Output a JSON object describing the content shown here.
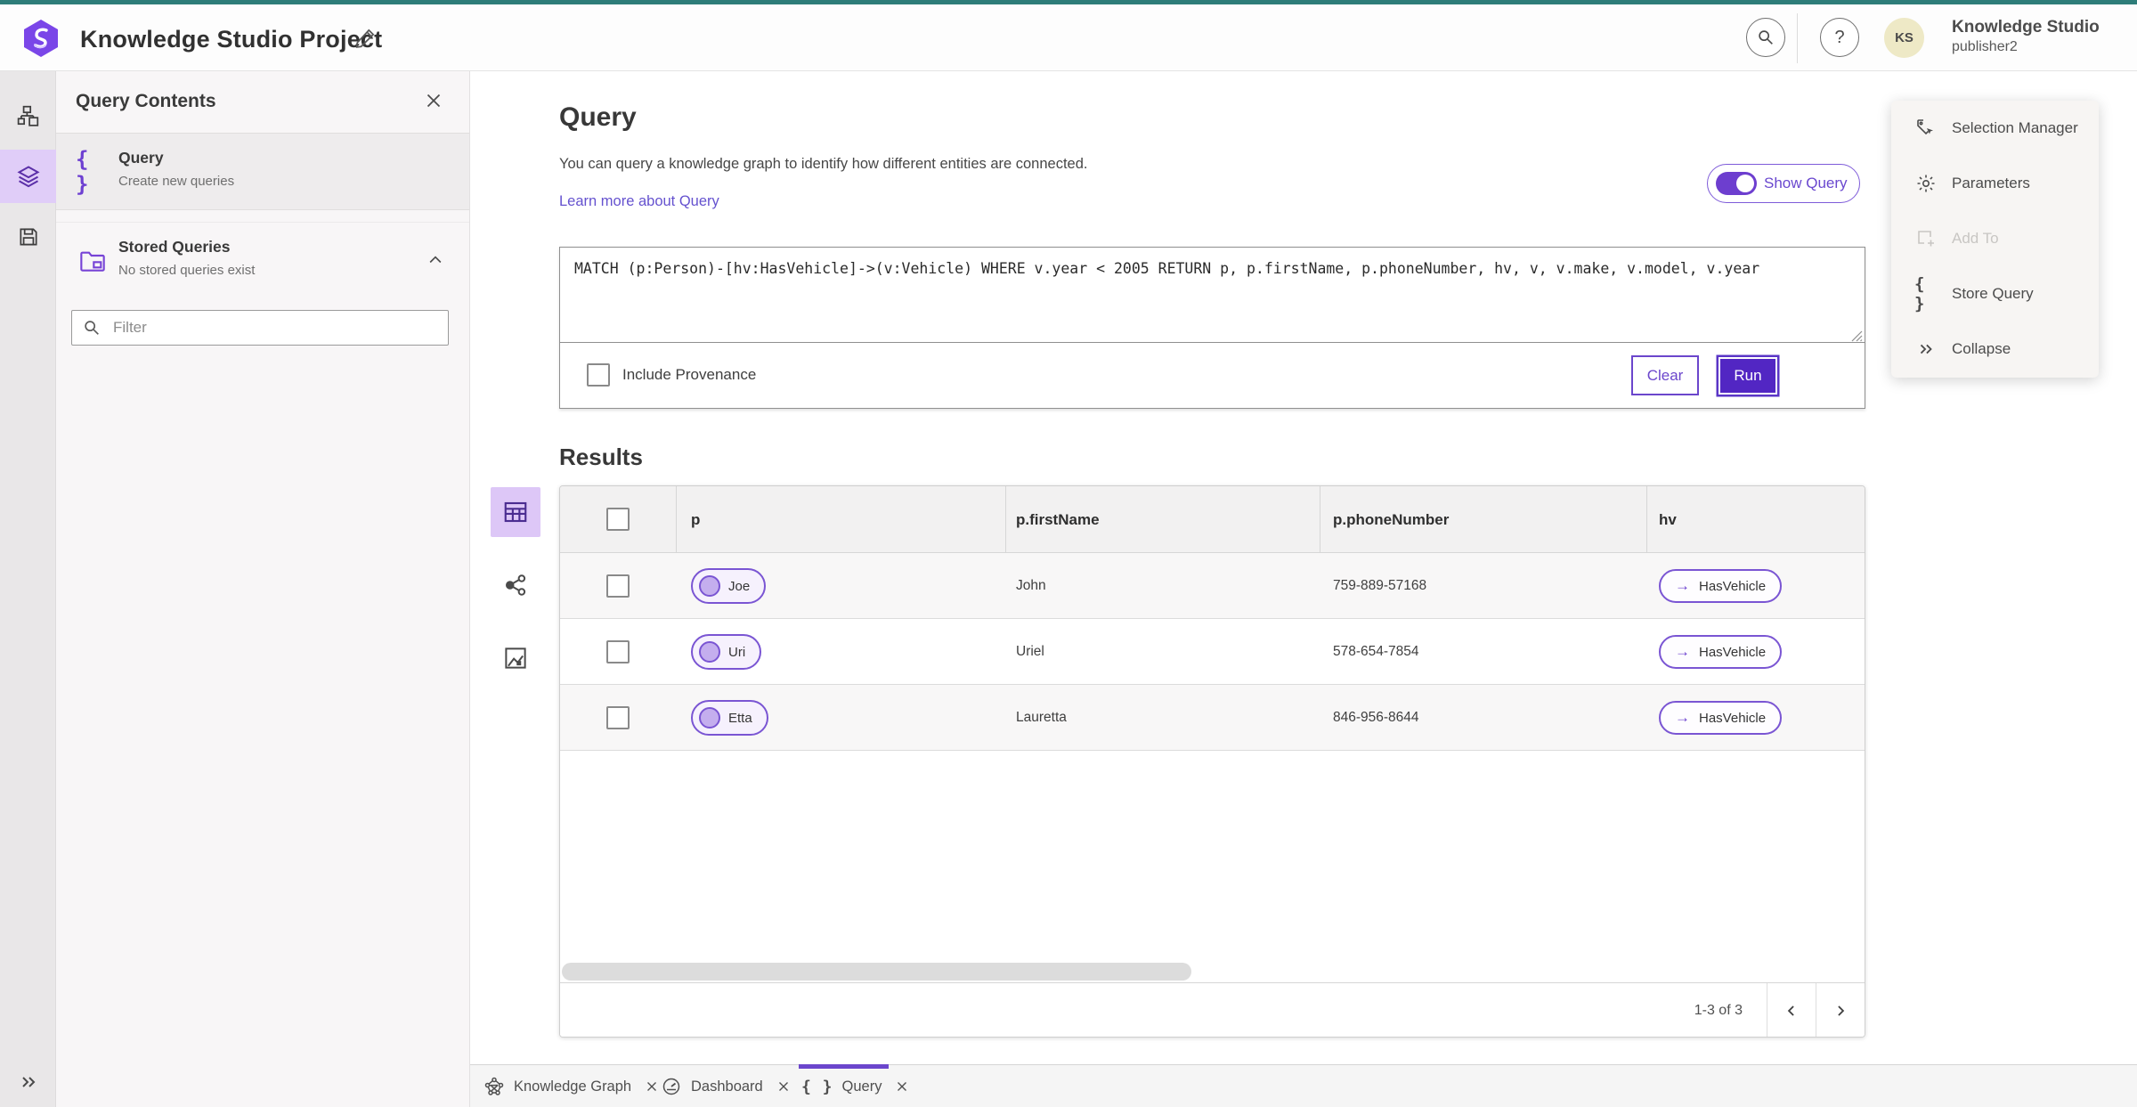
{
  "colors": {
    "brand_teal": "#2e7d79",
    "accent_purple": "#6b46cc",
    "run_button_purple": "#5226c3",
    "selected_rail_bg": "#e0cdf8",
    "node_pill_fill": "#f6f1fd"
  },
  "header": {
    "project_title": "Knowledge Studio Project",
    "app_name": "Knowledge Studio",
    "username": "publisher2",
    "avatar_initials": "KS",
    "help_glyph": "?"
  },
  "left_panel": {
    "title": "Query Contents",
    "query_item": {
      "label": "Query",
      "description": "Create new queries"
    },
    "stored_item": {
      "label": "Stored Queries",
      "description": "No stored queries exist"
    },
    "filter_placeholder": "Filter"
  },
  "query_section": {
    "heading": "Query",
    "description": "You can query a knowledge graph to identify how different entities are connected.",
    "learn_more": "Learn more about Query",
    "show_query_label": "Show Query",
    "query_text": "MATCH (p:Person)-[hv:HasVehicle]->(v:Vehicle) WHERE v.year < 2005 RETURN p, p.firstName, p.phoneNumber, hv, v, v.make, v.model, v.year",
    "include_provenance_label": "Include Provenance",
    "clear_label": "Clear",
    "run_label": "Run"
  },
  "results": {
    "heading": "Results",
    "columns": [
      "p",
      "p.firstName",
      "p.phoneNumber",
      "hv"
    ],
    "rows": [
      {
        "p": "Joe",
        "firstName": "John",
        "phoneNumber": "759-889-57168",
        "hv": "HasVehicle"
      },
      {
        "p": "Uri",
        "firstName": "Uriel",
        "phoneNumber": "578-654-7854",
        "hv": "HasVehicle"
      },
      {
        "p": "Etta",
        "firstName": "Lauretta",
        "phoneNumber": "846-956-8644",
        "hv": "HasVehicle"
      }
    ],
    "pagination": "1-3 of 3"
  },
  "right_panel": {
    "items": [
      {
        "label": "Selection Manager"
      },
      {
        "label": "Parameters"
      },
      {
        "label": "Add To"
      },
      {
        "label": "Store Query"
      },
      {
        "label": "Collapse"
      }
    ]
  },
  "tabs": [
    {
      "label": "Knowledge Graph"
    },
    {
      "label": "Dashboard"
    },
    {
      "label": "Query"
    }
  ],
  "icons": {
    "braces": "{ }",
    "arrow_right": "→"
  }
}
